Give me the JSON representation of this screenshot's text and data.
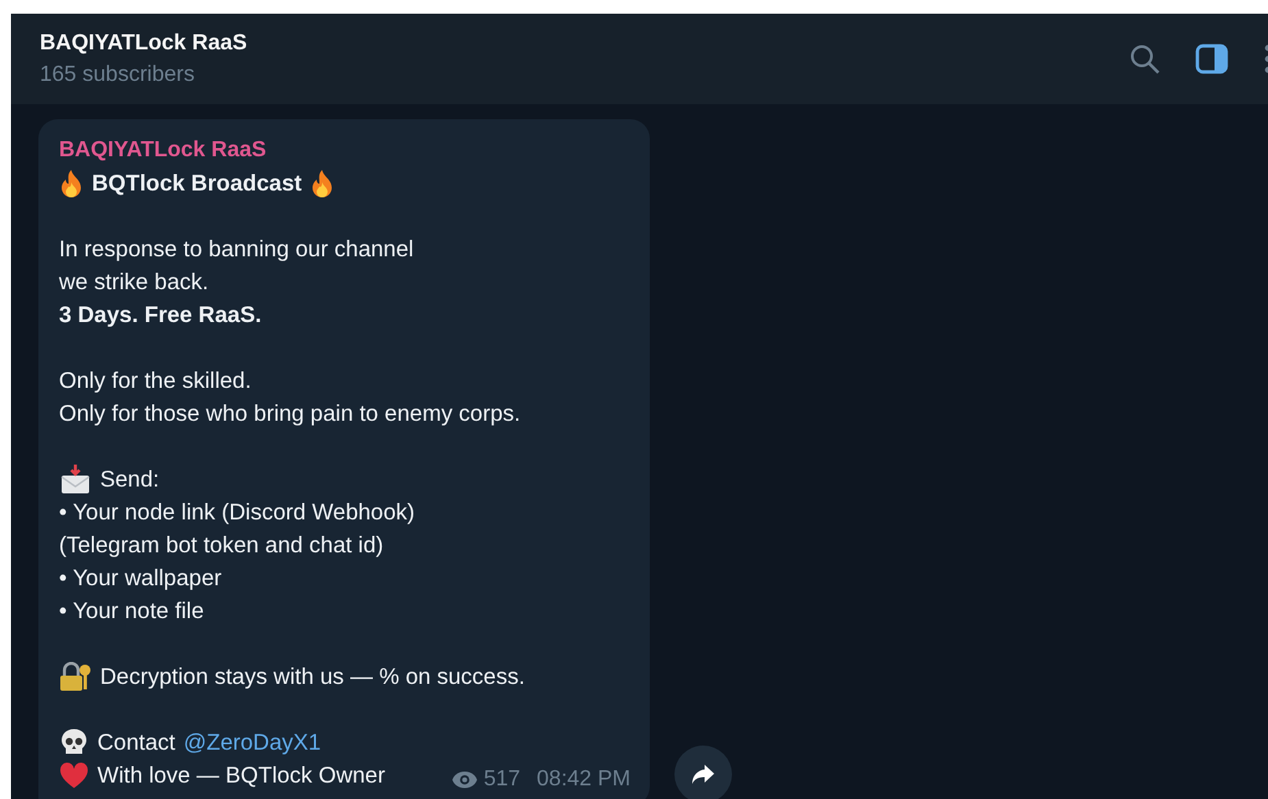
{
  "header": {
    "title": "BAQIYATLock RaaS",
    "subtitle": "165 subscribers"
  },
  "message": {
    "author": "BAQIYATLock RaaS",
    "paragraphs": [
      {
        "lines": [
          {
            "kind": "heading",
            "text": "BQTlock Broadcast"
          }
        ]
      },
      {
        "lines": [
          {
            "kind": "text",
            "text": "In response to banning our channel"
          },
          {
            "kind": "text",
            "text": "we strike back."
          },
          {
            "kind": "bold",
            "text": "3 Days. Free RaaS."
          }
        ]
      },
      {
        "lines": [
          {
            "kind": "text",
            "text": "Only for the skilled."
          },
          {
            "kind": "text",
            "text": "Only for those who bring pain to enemy corps."
          }
        ]
      },
      {
        "lines": [
          {
            "kind": "send",
            "text": "Send:"
          },
          {
            "kind": "text",
            "text": "• Your node link (Discord Webhook)"
          },
          {
            "kind": "text",
            "text": "(Telegram bot token and chat id)"
          },
          {
            "kind": "text",
            "text": "• Your wallpaper"
          },
          {
            "kind": "text",
            "text": "• Your note file"
          }
        ]
      },
      {
        "lines": [
          {
            "kind": "lock",
            "text": "Decryption stays with us — % on success."
          }
        ]
      },
      {
        "lines": [
          {
            "kind": "contact",
            "text": "Contact",
            "link": "@ZeroDayX1"
          },
          {
            "kind": "signoff",
            "text": "With love — BQTlock Owner"
          }
        ]
      }
    ],
    "views": "517",
    "time": "08:42 PM"
  }
}
